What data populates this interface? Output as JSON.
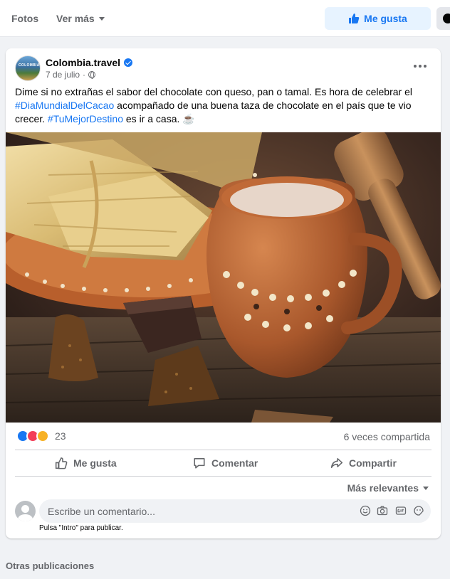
{
  "tabs": {
    "photos": "Fotos",
    "more": "Ver más"
  },
  "header": {
    "like_button": "Me gusta"
  },
  "post": {
    "page_name": "Colombia.travel",
    "date": "7 de julio",
    "separator": "·",
    "avatar_text": "COLOMBIA",
    "text_part1": "Dime si no extrañas el sabor del chocolate con queso, pan o tamal. Es hora de celebrar el ",
    "hashtag1": "#DiaMundialDelCacao",
    "text_part2": " acompañado de una buena taza de chocolate en el país que te vio crecer. ",
    "hashtag2": "#TuMejorDestino",
    "text_part3": " es ir a casa. ☕",
    "reaction_count": "23",
    "shares": "6 veces compartida",
    "actions": {
      "like": "Me gusta",
      "comment": "Comentar",
      "share": "Compartir"
    },
    "sort_label": "Más relevantes",
    "comment_placeholder": "Escribe un comentario...",
    "comment_hint": "Pulsa \"Intro\" para publicar."
  },
  "other_posts_title": "Otras publicaciones",
  "colors": {
    "accent": "#1877f2",
    "secondary_text": "#65676b",
    "background": "#f0f2f5"
  }
}
